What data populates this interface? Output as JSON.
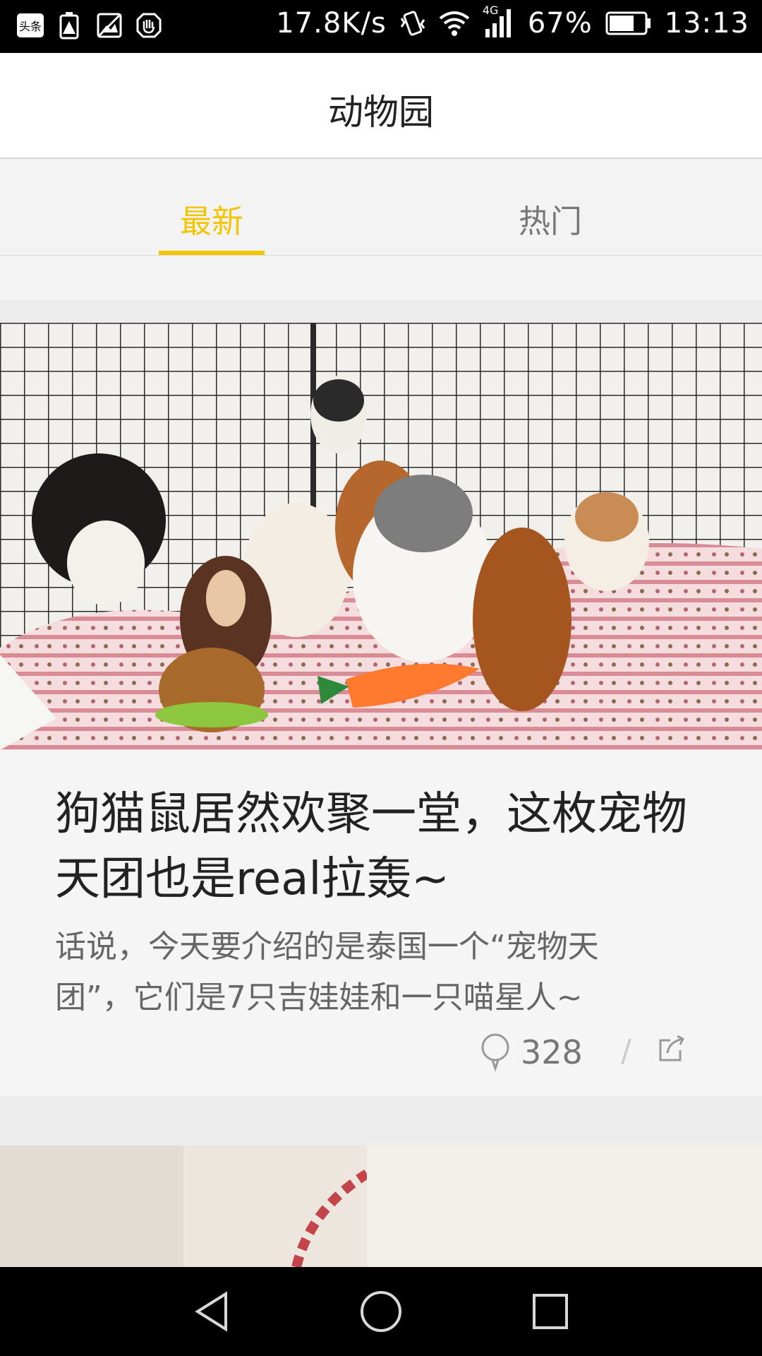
{
  "status_bar": {
    "network_speed": "17.8K/s",
    "network_type": "4G",
    "battery": "67%",
    "time": "13:13",
    "left_icons": [
      "toutiao-app-icon",
      "battery-warning-icon",
      "image-icon",
      "hand-icon"
    ]
  },
  "header": {
    "title": "动物园"
  },
  "tabs": [
    {
      "label": "最新",
      "selected": true
    },
    {
      "label": "热门",
      "selected": false
    }
  ],
  "colors": {
    "accent": "#f2c500",
    "tab_inactive": "#777777"
  },
  "feed": {
    "items": [
      {
        "title": "狗猫鼠居然欢聚一堂，这枚宠物天团也是real拉轰~",
        "summary": "话说，今天要介绍的是泰国一个“宠物天团”，它们是7只吉娃娃和一只喵星人~",
        "comments": "328",
        "separator": "/"
      }
    ]
  },
  "nav_bar": {
    "buttons": [
      "back-icon",
      "home-icon",
      "recents-icon"
    ]
  }
}
